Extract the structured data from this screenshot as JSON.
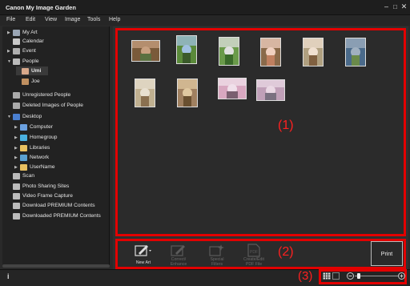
{
  "window": {
    "title": "Canon My Image Garden"
  },
  "menu": [
    "File",
    "Edit",
    "View",
    "Image",
    "Tools",
    "Help"
  ],
  "sidebar": {
    "items": [
      {
        "label": "My Art",
        "arrow": "▶",
        "icon": "my-art-icon",
        "color": "#9aa6b4"
      },
      {
        "label": "Calendar",
        "arrow": "",
        "icon": "calendar-icon",
        "color": "#c8c8c8"
      },
      {
        "label": "Event",
        "arrow": "▶",
        "icon": "event-icon",
        "color": "#b0b0b0"
      },
      {
        "label": "People",
        "arrow": "▼",
        "icon": "people-icon",
        "color": "#bbbbbb"
      },
      {
        "label": "Umi",
        "arrow": "",
        "icon": "umi-face-icon",
        "color": "#d8a88a"
      },
      {
        "label": "Joe",
        "arrow": "",
        "icon": "joe-face-icon",
        "color": "#c09060"
      },
      {
        "label": "Unregistered People",
        "arrow": "",
        "icon": "unregistered-people-icon",
        "color": "#aaaaaa"
      },
      {
        "label": "Deleted Images of People",
        "arrow": "",
        "icon": "deleted-people-icon",
        "color": "#aaaaaa"
      },
      {
        "label": "Desktop",
        "arrow": "▼",
        "icon": "desktop-icon",
        "color": "#4a7fd0"
      },
      {
        "label": "Computer",
        "arrow": "▶",
        "icon": "computer-icon",
        "color": "#6aa0e0"
      },
      {
        "label": "Homegroup",
        "arrow": "▶",
        "icon": "homegroup-icon",
        "color": "#4ab0e0"
      },
      {
        "label": "Libraries",
        "arrow": "▶",
        "icon": "libraries-icon",
        "color": "#e8c060"
      },
      {
        "label": "Network",
        "arrow": "▶",
        "icon": "network-icon",
        "color": "#5aa0d0"
      },
      {
        "label": "UserName",
        "arrow": "▶",
        "icon": "user-folder-icon",
        "color": "#e8c060"
      },
      {
        "label": "Scan",
        "arrow": "",
        "icon": "scan-icon",
        "color": "#bbbbbb"
      },
      {
        "label": "Photo Sharing Sites",
        "arrow": "",
        "icon": "photo-sharing-icon",
        "color": "#bbbbbb"
      },
      {
        "label": "Video Frame Capture",
        "arrow": "",
        "icon": "video-capture-icon",
        "color": "#bbbbbb"
      },
      {
        "label": "Download PREMIUM Contents",
        "arrow": "",
        "icon": "download-premium-icon",
        "color": "#bbbbbb"
      },
      {
        "label": "Downloaded PREMIUM Contents",
        "arrow": "",
        "icon": "downloaded-premium-icon",
        "color": "#bbbbbb"
      }
    ]
  },
  "thumbnails": [
    {
      "orientation": "landscape",
      "palette": [
        "#7a5a3a",
        "#c8a080",
        "#5a7040"
      ]
    },
    {
      "orientation": "portrait",
      "palette": [
        "#5a8a3a",
        "#a0c0e0",
        "#3a5a2a"
      ]
    },
    {
      "orientation": "portrait",
      "palette": [
        "#6a9a4a",
        "#e0e0e0",
        "#3a6a2a"
      ]
    },
    {
      "orientation": "portrait",
      "palette": [
        "#8a6a4a",
        "#f0d0c0",
        "#c08060"
      ]
    },
    {
      "orientation": "portrait",
      "palette": [
        "#b0a080",
        "#f0e0d0",
        "#806040"
      ]
    },
    {
      "orientation": "portrait",
      "palette": [
        "#4a6a8a",
        "#a0b0c0",
        "#6a8a4a"
      ]
    },
    {
      "orientation": "portrait",
      "palette": [
        "#c0b090",
        "#e8e0d0",
        "#8a7050"
      ]
    },
    {
      "orientation": "portrait",
      "palette": [
        "#a08060",
        "#e0c8a0",
        "#6a5030"
      ]
    },
    {
      "orientation": "landscape",
      "palette": [
        "#d8a8c0",
        "#f0e0ea",
        "#7a6070"
      ]
    },
    {
      "orientation": "landscape",
      "palette": [
        "#c0a0b8",
        "#ead8e4",
        "#7a7080"
      ]
    }
  ],
  "regions": {
    "region1": "(1)",
    "region2": "(2)",
    "region3": "(3)"
  },
  "toolbar": {
    "new_art": "New Art",
    "correct_enhance": [
      "Correct/",
      "Enhance"
    ],
    "special_filters": [
      "Special",
      "Filters"
    ],
    "create_pdf": [
      "Create/Edit",
      "PDF File"
    ],
    "print": "Print"
  },
  "zoom": {
    "level": 0.1
  },
  "colors": {
    "highlight": "#e30000",
    "background": "#2b2b2b"
  }
}
